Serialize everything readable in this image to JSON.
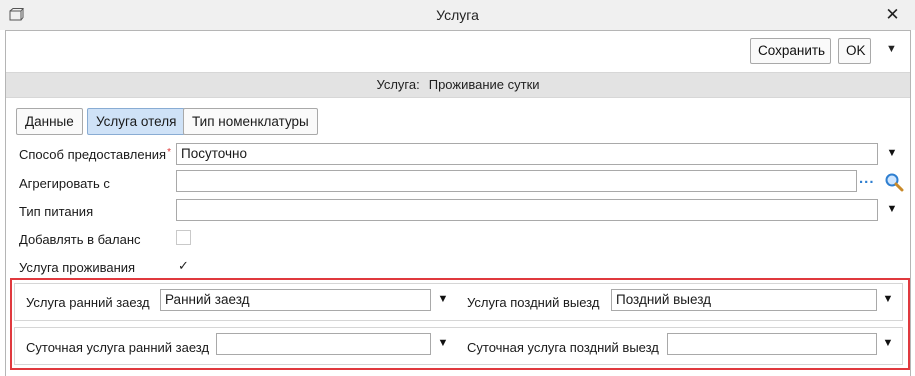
{
  "window": {
    "title": "Услуга",
    "close_glyph": "✕"
  },
  "toolbar": {
    "save_label": "Сохранить",
    "ok_label": "OK",
    "more_glyph": "▼"
  },
  "header": {
    "label": "Услуга:",
    "value": "Проживание сутки"
  },
  "tabs": [
    {
      "label": "Данные",
      "active": false
    },
    {
      "label": "Услуга отеля",
      "active": true
    },
    {
      "label": "Тип номенклатуры",
      "active": false
    }
  ],
  "form": {
    "provision_method": {
      "label": "Способ предоставления",
      "required_mark": "*",
      "value": "Посуточно"
    },
    "aggregate_with": {
      "label": "Агрегировать с",
      "value": "",
      "dots": "..."
    },
    "meal_type": {
      "label": "Тип питания",
      "value": ""
    },
    "add_to_balance": {
      "label": "Добавлять в баланс",
      "checked": false
    },
    "accommodation_service": {
      "label": "Услуга проживания",
      "checked": true,
      "check_glyph": "✓"
    }
  },
  "checkin_checkout": {
    "early_checkin": {
      "label": "Услуга ранний заезд",
      "value": "Ранний заезд"
    },
    "late_checkout": {
      "label": "Услуга поздний выезд",
      "value": "Поздний выезд"
    },
    "daily_early_checkin": {
      "label": "Суточная услуга ранний заезд",
      "value": ""
    },
    "daily_late_checkout": {
      "label": "Суточная услуга поздний выезд",
      "value": ""
    }
  },
  "caret_glyph": "▼",
  "colors": {
    "active_tab": "#cfe2f7",
    "highlight_border": "#e0393e",
    "band": "#e3e3e3",
    "search_icon": "#2f7fd0"
  }
}
